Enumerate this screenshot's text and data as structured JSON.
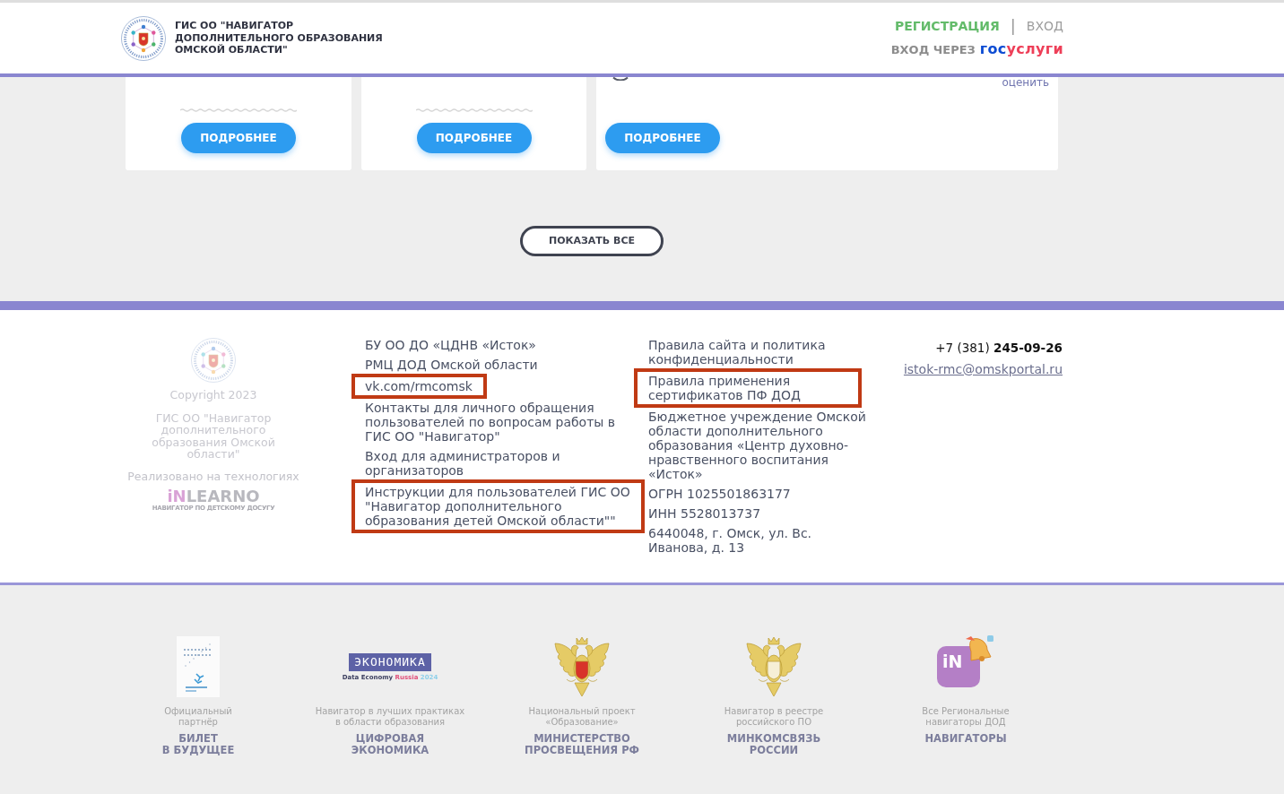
{
  "header": {
    "title": "ГИС ОО \"НАВИГАТОР\nДОПОЛНИТЕЛЬНОГО ОБРАЗОВАНИЯ\nОМСКОЙ ОБЛАСТИ\"",
    "register_link": "РЕГИСТРАЦИЯ",
    "separator": "|",
    "login_link": "ВХОД",
    "gosuslugi_login": {
      "label": "ВХОД ЧЕРЕЗ",
      "logo_parts": [
        "гос",
        "услуги"
      ]
    }
  },
  "cards": [
    {
      "kind": "wave",
      "button": "ПОДРОБНЕЕ"
    },
    {
      "kind": "wave",
      "button": "ПОДРОБНЕЕ"
    },
    {
      "kind": "rating",
      "rate_link": "оценить",
      "button": "ПОДРОБНЕЕ"
    }
  ],
  "show_all_button": "ПОКАЗАТЬ ВСЕ",
  "footer": {
    "about": {
      "copyright": "Copyright 2023",
      "project_name": "ГИС ОО \"Навигатор\nдополнительного\nобразования Омской\nобласти\"",
      "powered_by": "Реализовано на технологиях",
      "platform_logo": {
        "parts": [
          "iN",
          "LEARNO"
        ],
        "tagline": "НАВИГАТОР ПО ДЕТСКОМУ ДОСУГУ"
      }
    },
    "organization": [
      "БУ ОО ДО «ЦДНВ «Исток»",
      "РМЦ ДОД Омской области"
    ],
    "links": [
      {
        "text": "vk.com/rmcomsk",
        "highlighted": true
      },
      {
        "text": "Контакты для личного обращения\nпользователей по вопросам работы в\nГИС ОО \"Навигатор\"",
        "highlighted": false
      },
      {
        "text": "Вход для администраторов и\nорганизаторов",
        "highlighted": false
      },
      {
        "text": "Инструкции для пользователей ГИС ОО\n\"Навигатор дополнительного\nобразования детей Омской области\"\"",
        "highlighted": true
      }
    ],
    "policy_links": [
      {
        "text": "Правила сайта и политика\nконфиденциальности",
        "highlighted": false
      },
      {
        "text": "Правила применения\nсертификатов ПФ ДОД",
        "highlighted": true
      }
    ],
    "legal_details": [
      "Бюджетное учреждение Омской\nобласти дополнительного\nобразования «Центр духовно-нравственного воспитания\n«Исток»",
      "ОГРН 1025501863177",
      "ИНН 5528013737",
      "6440048, г. Омск, ул. Вс.\nИванова, д. 13"
    ],
    "contacts": {
      "phone": "+7 (381) **245-09-26**",
      "email": "istok-rmc@omskportal.ru"
    }
  },
  "partners": [
    {
      "kind": "ticket",
      "caption": "Официальный\nпартнёр",
      "title": "БИЛЕТ\nВ БУДУЩЕЕ"
    },
    {
      "kind": "economy",
      "logo_text": "ЭКОНОМИКА",
      "logo_tagline": [
        "Data Economy",
        "Russia",
        "2024"
      ],
      "caption": "Навигатор в лучших практиках\nв области образования",
      "title": "ЦИФРОВАЯ\nЭКОНОМИКА"
    },
    {
      "kind": "emblem_red",
      "caption": "Национальный проект\n«Образование»",
      "title": "МИНИСТЕРСТВО\nПРОСВЕЩЕНИЯ РФ"
    },
    {
      "kind": "emblem_gold",
      "caption": "Навигатор в реестре\nроссийского ПО",
      "title": "МИНКОМСВЯЗЬ\nРОССИИ"
    },
    {
      "kind": "navigators",
      "logo_text": "iN",
      "caption": "Все Региональные\nнавигаторы ДОД",
      "title": "НАВИГАТОРЫ"
    }
  ]
}
